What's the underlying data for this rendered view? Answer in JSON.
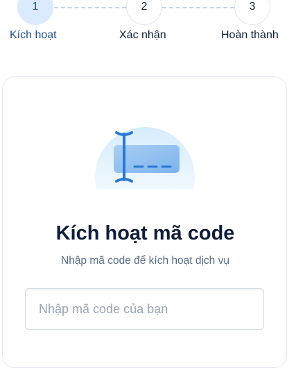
{
  "stepper": {
    "steps": [
      {
        "number": "1",
        "label": "Kích hoạt",
        "active": true
      },
      {
        "number": "2",
        "label": "Xác nhận",
        "active": false
      },
      {
        "number": "3",
        "label": "Hoàn thành",
        "active": false
      }
    ]
  },
  "card": {
    "illustration_icon": "card-with-text-cursor-icon",
    "title": "Kích hoạt mã code",
    "subtitle": "Nhập mã code để kích hoạt dịch vụ",
    "input": {
      "value": "",
      "placeholder": "Nhập mã code của bạn"
    }
  },
  "colors": {
    "primary": "#1d4f91",
    "active_step_bg": "#dbeafe",
    "title_text": "#0f1d3a",
    "muted_text": "#5a6b85"
  }
}
